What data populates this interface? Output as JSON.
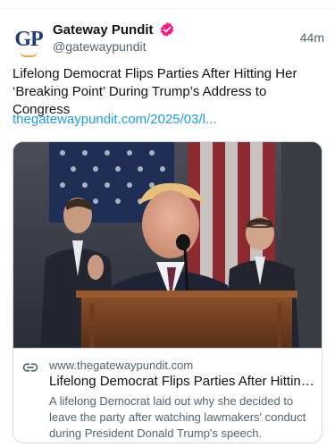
{
  "account": {
    "display_name": "Gateway Pundit",
    "handle": "@gatewaypundit",
    "avatar_text": "GP",
    "verified": true
  },
  "post": {
    "timestamp": "44m",
    "text": "Lifelong Democrat Flips Parties After Hitting Her ‘Breaking Point’ During Trump’s Address to Congress",
    "link_text": "thegatewaypundit.com/2025/03/l..."
  },
  "link_card": {
    "domain": "www.thegatewaypundit.com",
    "title": "Lifelong Democrat Flips Parties After Hitting H...",
    "description": "A lifelong Democrat laid out why she decided to leave the party after watching lawmakers' conduct during President Donald Trump's speech."
  },
  "colors": {
    "link": "#1d9bf0",
    "verified_badge": "#f91880",
    "brand_navy": "#1d3d7a",
    "brand_orange": "#e9a43b"
  },
  "icons": {
    "verified": "verified-badge-icon",
    "link": "link-icon"
  }
}
